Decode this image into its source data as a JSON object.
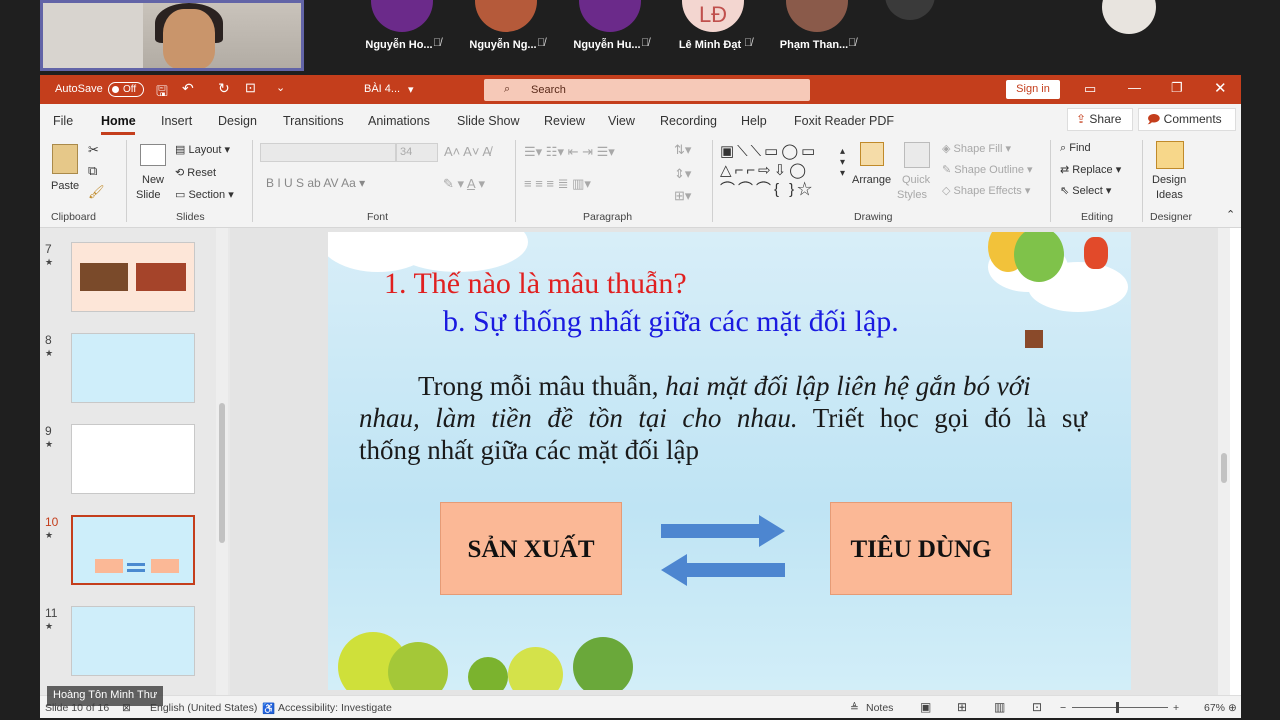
{
  "meeting": {
    "participants": [
      {
        "name": "Nguyễn Ho...",
        "avatar_color": "#6b2a8a"
      },
      {
        "name": "Nguyễn Ng...",
        "avatar_color": "#b55a3a"
      },
      {
        "name": "Nguyễn Hu...",
        "avatar_color": "#6b2a8a"
      },
      {
        "name": "Lê Minh Đạt",
        "avatar_color": "#f3d6d0",
        "initials": "LĐ"
      },
      {
        "name": "Phạm Than...",
        "avatar_color": "#8a5a4a"
      }
    ],
    "presenter_label": "Hoàng Tôn Minh Thư"
  },
  "titlebar": {
    "autosave_label": "AutoSave",
    "autosave_state": "Off",
    "filename": "BÀI 4...",
    "search_placeholder": "Search",
    "signin": "Sign in"
  },
  "menu": {
    "items": [
      "File",
      "Home",
      "Insert",
      "Design",
      "Transitions",
      "Animations",
      "Slide Show",
      "Review",
      "View",
      "Recording",
      "Help",
      "Foxit Reader PDF"
    ],
    "active": "Home",
    "share": "Share",
    "comments": "Comments"
  },
  "ribbon": {
    "clipboard": {
      "paste": "Paste",
      "label": "Clipboard"
    },
    "slides": {
      "new_slide_1": "New",
      "new_slide_2": "Slide",
      "layout": "Layout",
      "reset": "Reset",
      "section": "Section",
      "label": "Slides"
    },
    "font": {
      "size": "34",
      "label": "Font"
    },
    "paragraph": {
      "label": "Paragraph"
    },
    "drawing": {
      "arrange": "Arrange",
      "quick_styles_1": "Quick",
      "quick_styles_2": "Styles",
      "shape_fill": "Shape Fill",
      "shape_outline": "Shape Outline",
      "shape_effects": "Shape Effects",
      "label": "Drawing"
    },
    "editing": {
      "find": "Find",
      "replace": "Replace",
      "select": "Select",
      "label": "Editing"
    },
    "designer": {
      "design_ideas_1": "Design",
      "design_ideas_2": "Ideas",
      "label": "Designer"
    }
  },
  "thumbnails": [
    {
      "num": "7"
    },
    {
      "num": "8"
    },
    {
      "num": "9"
    },
    {
      "num": "10",
      "selected": true
    },
    {
      "num": "11"
    }
  ],
  "slide": {
    "heading": "1. Thế nào là mâu thuẫn?",
    "subheading": "b. Sự thống nhất giữa các mặt đối lập.",
    "para_line1_a": "Trong mỗi mâu thuẫn, ",
    "para_line1_b": "hai mặt đối lập liên hệ gắn bó với",
    "para_line2_a": "nhau, làm tiền đề tồn tại cho nhau.",
    "para_line2_b": " Triết học gọi đó là sự",
    "para_line3": "thống nhất giữa các mặt đối lập",
    "box_left": "SẢN XUẤT",
    "box_right": "TIÊU DÙNG",
    "heading_color": "#e02020",
    "subheading_color": "#1a1ae0"
  },
  "statusbar": {
    "slide_info": "Slide 10 of 16",
    "language": "English (United States)",
    "accessibility": "Accessibility: Investigate",
    "notes": "Notes",
    "zoom": "67%"
  }
}
